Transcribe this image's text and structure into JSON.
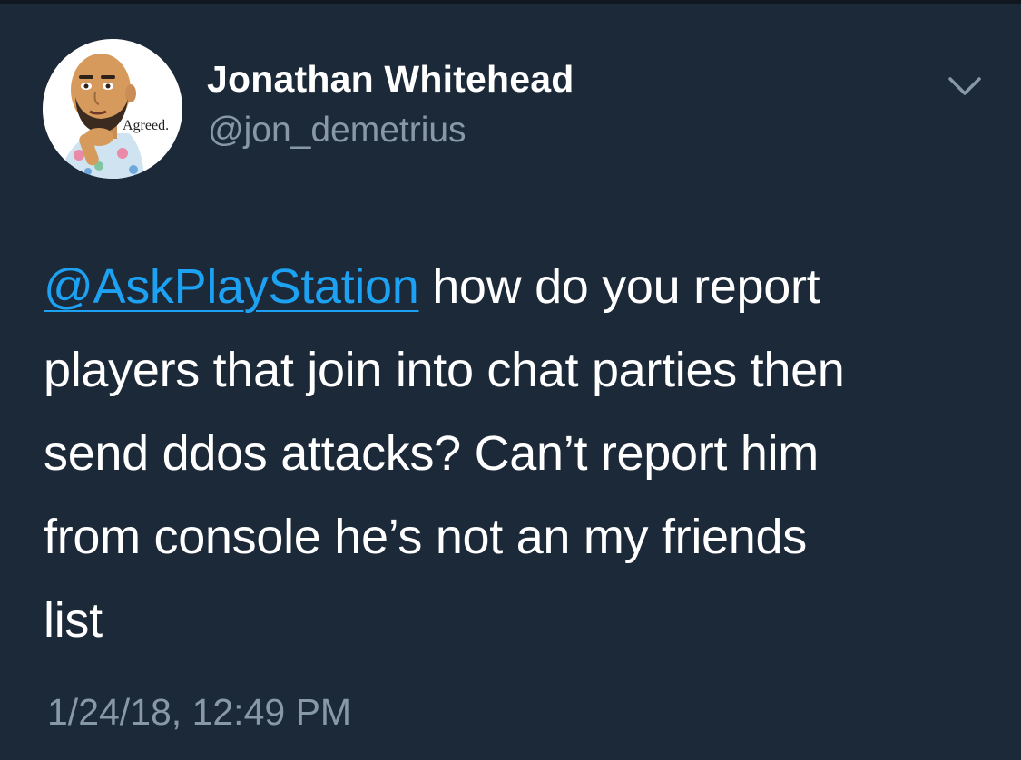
{
  "user": {
    "display_name": "Jonathan Whitehead",
    "handle": "@jon_demetrius",
    "avatar_caption": "Agreed."
  },
  "tweet": {
    "mention": "@AskPlayStation",
    "line1_rest": " how do you report",
    "line2": "players that join into chat parties then",
    "line3": "send ddos attacks? Can’t report him",
    "line4": "from console he’s not an my friends",
    "line5": "list",
    "timestamp": "1/24/18, 12:49 PM"
  },
  "icons": {
    "menu": "chevron-down-icon"
  },
  "colors": {
    "background": "#1c2938",
    "link": "#1da1f2",
    "secondary_text": "#8899a6",
    "primary_text": "#ffffff"
  }
}
